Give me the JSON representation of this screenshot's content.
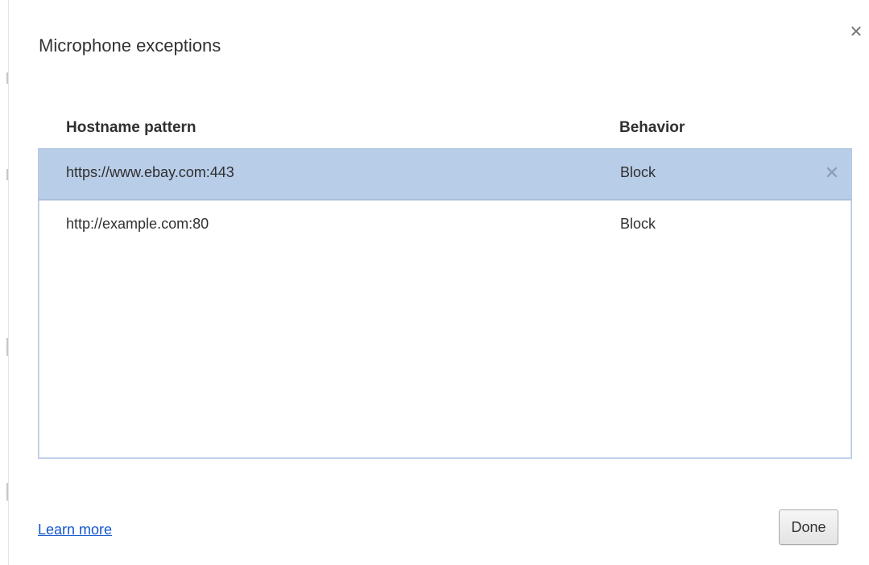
{
  "dialog": {
    "title": "Microphone exceptions",
    "close_icon": "close-icon"
  },
  "table": {
    "headers": {
      "hostname": "Hostname pattern",
      "behavior": "Behavior"
    },
    "rows": [
      {
        "hostname": "https://www.ebay.com:443",
        "behavior": "Block",
        "selected": true
      },
      {
        "hostname": "http://example.com:80",
        "behavior": "Block",
        "selected": false
      }
    ],
    "remove_icon": "remove-icon"
  },
  "footer": {
    "learn_more": "Learn more",
    "done": "Done"
  },
  "colors": {
    "selected_row": "#b8cde8",
    "link": "#1155cc",
    "list_border": "#b7c9e3"
  }
}
